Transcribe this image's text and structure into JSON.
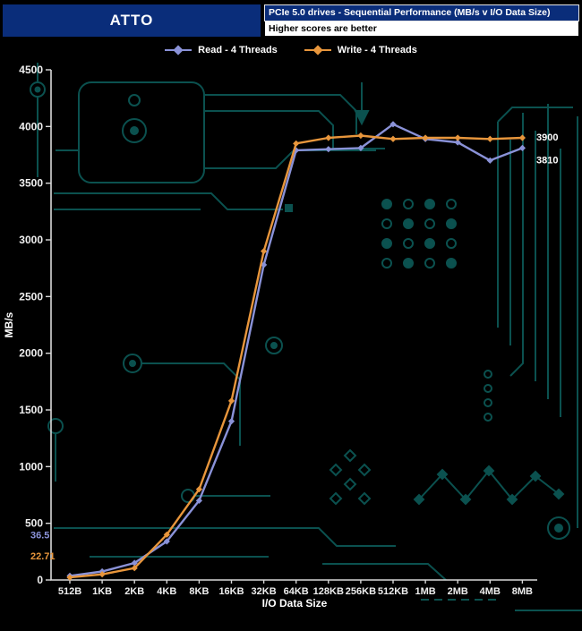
{
  "header": {
    "app_title": "ATTO",
    "chart_title": "PCIe 5.0 drives - Sequential Performance (MB/s v I/O Data Size)",
    "subtitle": "Higher scores are better"
  },
  "legend": [
    {
      "label": "Read - 4 Threads",
      "color": "#8a92d8"
    },
    {
      "label": "Write - 4 Threads",
      "color": "#e8963c"
    }
  ],
  "chart_data": {
    "type": "line",
    "title": "PCIe 5.0 drives - Sequential Performance (MB/s v I/O Data Size)",
    "subtitle": "Higher scores are better",
    "categories": [
      "512B",
      "1KB",
      "2KB",
      "4KB",
      "8KB",
      "16KB",
      "32KB",
      "64KB",
      "128KB",
      "256KB",
      "512KB",
      "1MB",
      "2MB",
      "4MB",
      "8MB"
    ],
    "series": [
      {
        "name": "Read - 4 Threads",
        "color": "#8a92d8",
        "values": [
          36.5,
          75,
          150,
          340,
          700,
          1400,
          2780,
          3790,
          3800,
          3810,
          4020,
          3890,
          3860,
          3700,
          3810
        ]
      },
      {
        "name": "Write - 4 Threads",
        "color": "#e8963c",
        "values": [
          22.71,
          50,
          105,
          400,
          800,
          1580,
          2900,
          3850,
          3900,
          3920,
          3890,
          3900,
          3900,
          3890,
          3900
        ]
      }
    ],
    "xlabel": "I/O Data Size",
    "ylabel": "MB/s",
    "ylim": [
      0,
      4500
    ],
    "ytick_step": 500,
    "grid": false,
    "legend_position": "top",
    "annotations": {
      "read_start": "36.5",
      "write_start": "22.71",
      "read_end": "3810",
      "write_end": "3900"
    }
  },
  "colors": {
    "background": "#000000",
    "header_blue": "#0a2d7a",
    "circuit_teal": "#0d5a58",
    "axis": "#d9d9d9",
    "read_line": "#8a92d8",
    "write_line": "#e8963c"
  }
}
